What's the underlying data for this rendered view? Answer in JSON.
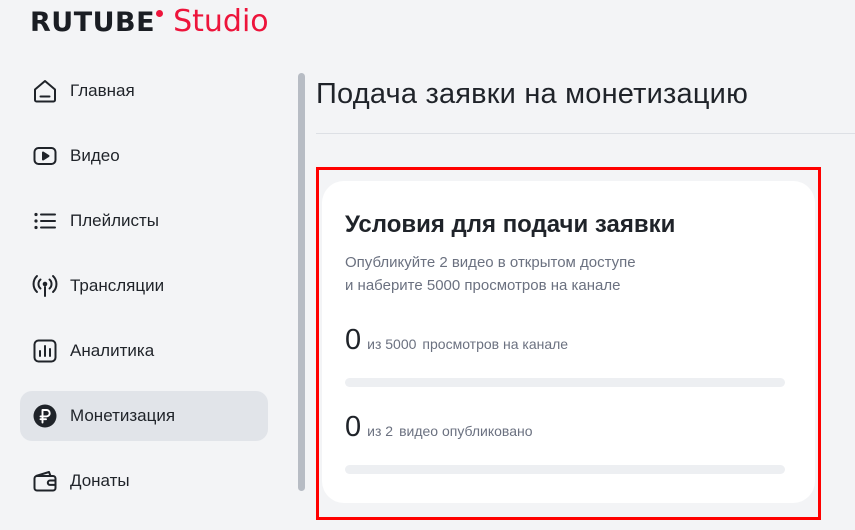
{
  "logo": {
    "brand": "RUTUBE",
    "product": "Studio",
    "accent_color": "#ed143b"
  },
  "sidebar": {
    "items": [
      {
        "label": "Главная",
        "icon": "home-icon",
        "active": false
      },
      {
        "label": "Видео",
        "icon": "video-play-icon",
        "active": false
      },
      {
        "label": "Плейлисты",
        "icon": "playlist-icon",
        "active": false
      },
      {
        "label": "Трансляции",
        "icon": "broadcast-icon",
        "active": false
      },
      {
        "label": "Аналитика",
        "icon": "analytics-icon",
        "active": false
      },
      {
        "label": "Монетизация",
        "icon": "ruble-icon",
        "active": true
      },
      {
        "label": "Донаты",
        "icon": "wallet-icon",
        "active": false
      }
    ]
  },
  "main": {
    "title": "Подача заявки на монетизацию",
    "card": {
      "title": "Условия для подачи заявки",
      "description_line1": "Опубликуйте 2 видео в открытом доступе",
      "description_line2": "и наберите 5000 просмотров на канале",
      "views": {
        "value": "0",
        "of": "из 5000",
        "label": "просмотров на канале",
        "progress": 0
      },
      "videos": {
        "value": "0",
        "of": "из 2",
        "label": "видео опубликовано",
        "progress": 0
      }
    }
  },
  "colors": {
    "accent": "#ed143b",
    "highlight_border": "#ff0000",
    "active_bg": "#e1e4e9"
  }
}
